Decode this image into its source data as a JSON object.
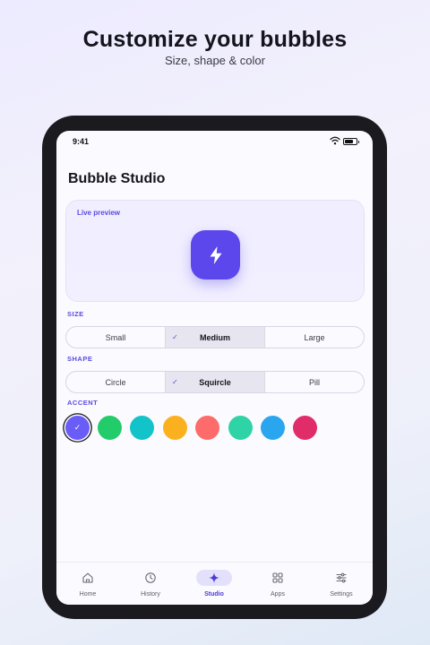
{
  "promo": {
    "headline": "Customize your bubbles",
    "subhead": "Size, shape & color"
  },
  "status": {
    "time": "9:41"
  },
  "app": {
    "title": "Bubble Studio"
  },
  "preview": {
    "label": "Live preview",
    "icon": "lightning-bolt-icon",
    "bubble_color": "#5b47eb"
  },
  "size": {
    "label": "SIZE",
    "options": [
      "Small",
      "Medium",
      "Large"
    ],
    "selected": "Medium"
  },
  "shape": {
    "label": "SHAPE",
    "options": [
      "Circle",
      "Squircle",
      "Pill"
    ],
    "selected": "Squircle"
  },
  "accent": {
    "label": "ACCENT",
    "colors": [
      "#6a5cf6",
      "#22cc6a",
      "#12c3c9",
      "#fbb020",
      "#fd6b6b",
      "#2ed4a6",
      "#2aa6ef",
      "#e12c6a"
    ],
    "selected_index": 0
  },
  "tabs": [
    {
      "label": "Home",
      "icon": "home-icon"
    },
    {
      "label": "History",
      "icon": "clock-icon"
    },
    {
      "label": "Studio",
      "icon": "sparkle-icon",
      "active": true
    },
    {
      "label": "Apps",
      "icon": "grid-icon"
    },
    {
      "label": "Settings",
      "icon": "sliders-icon"
    }
  ],
  "colors": {
    "accent": "#5b4be0",
    "device": "#1b1a1f"
  }
}
